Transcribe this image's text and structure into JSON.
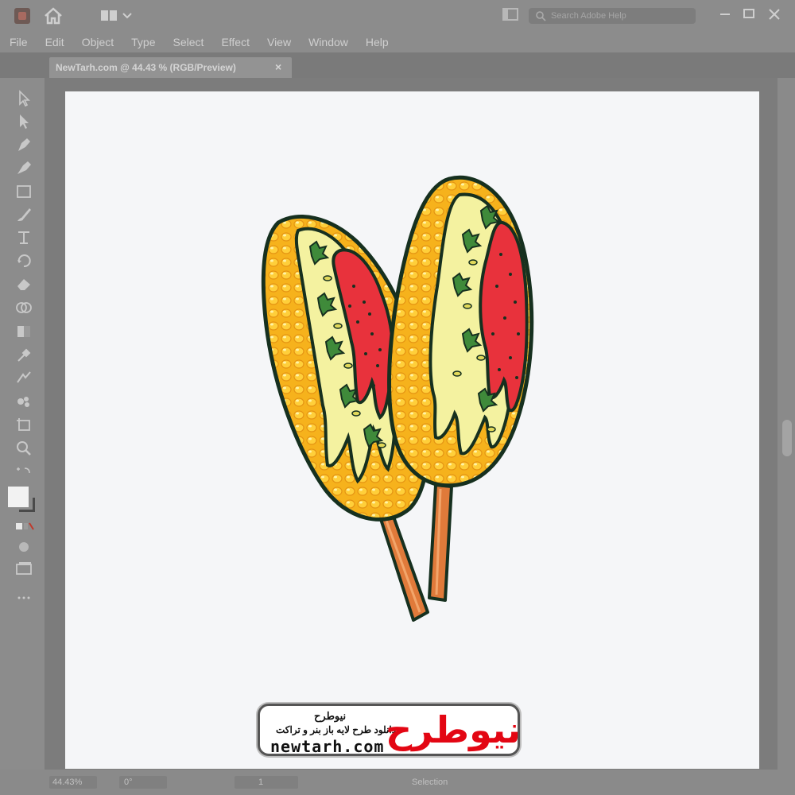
{
  "menu": [
    "File",
    "Edit",
    "Object",
    "Type",
    "Select",
    "Effect",
    "View",
    "Window",
    "Help"
  ],
  "search": {
    "placeholder": "Search Adobe Help"
  },
  "document_tab": {
    "title": "NewTarh.com @ 44.43 % (RGB/Preview)",
    "close": "×"
  },
  "status": {
    "zoom": "44.43%",
    "rotation": "0°",
    "artboard": "1",
    "tool": "Selection"
  },
  "watermark": {
    "brand_fa": "نیوطرح",
    "tagline_fa": "دانلود طرح لایه باز بنر و تراکت",
    "url": "newtarh.com",
    "logo_fa": "نیوطرح"
  },
  "colors": {
    "corn": "#f6b21c",
    "corn_light": "#ffd84a",
    "mayo": "#f4f2a0",
    "chili": "#e8323c",
    "herb": "#3f8a3a",
    "stick": "#e07a3a",
    "outline": "#16301f"
  }
}
